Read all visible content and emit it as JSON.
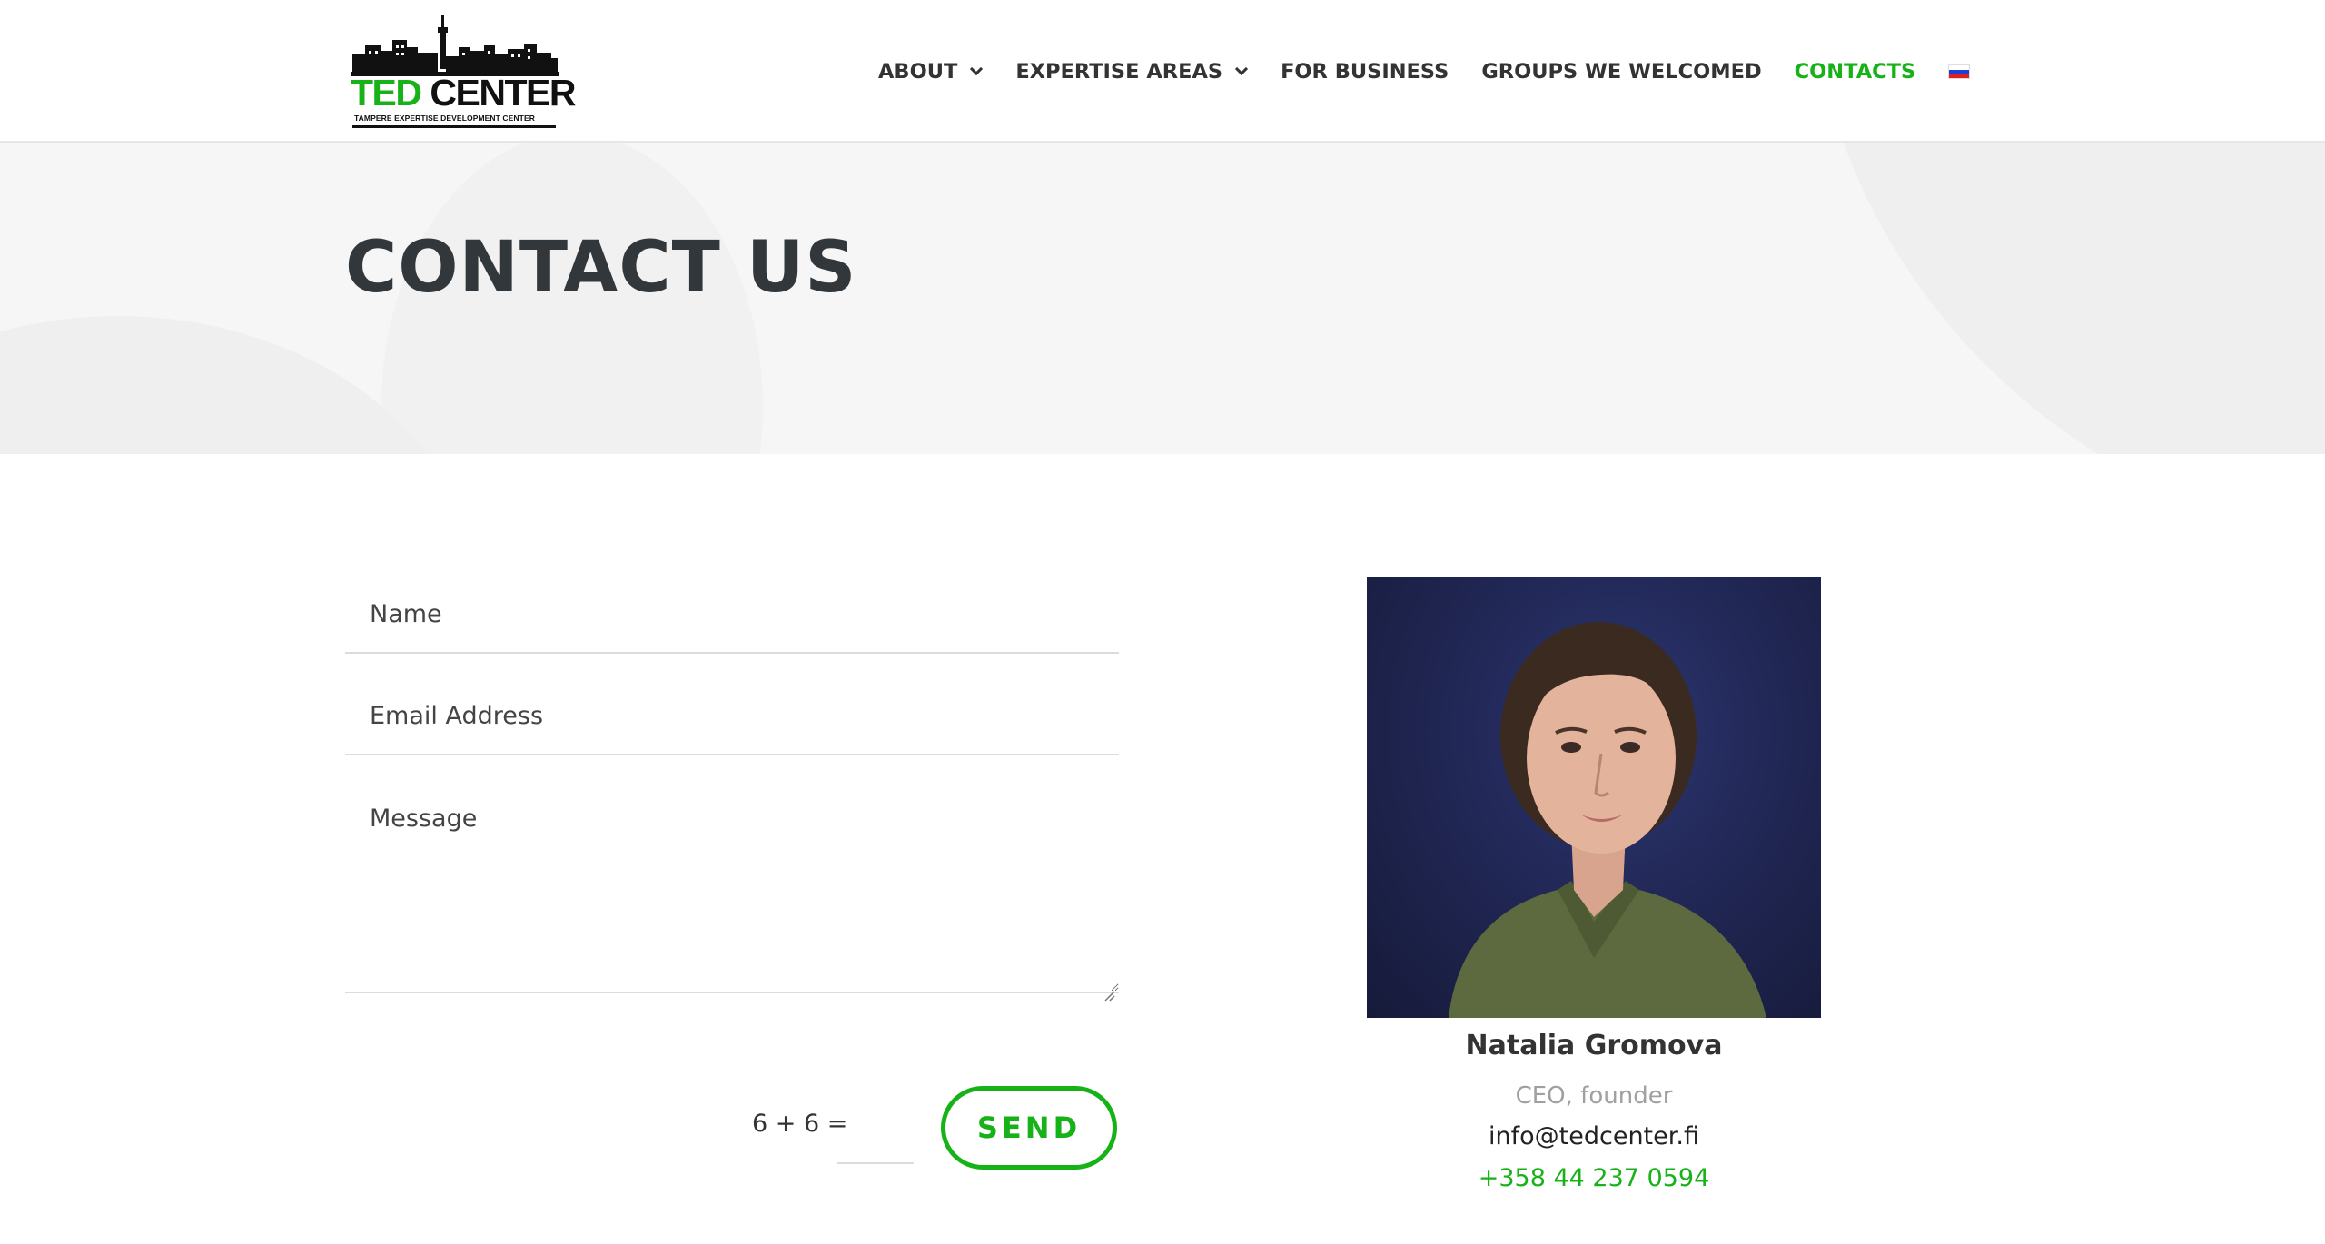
{
  "brand": {
    "logo_word_green": "TED",
    "logo_word_black": "CENTER",
    "logo_subtitle": "TAMPERE EXPERTISE DEVELOPMENT CENTER",
    "accent_color": "#17b217",
    "text_color": "#333333"
  },
  "nav": {
    "items": [
      {
        "label": "ABOUT",
        "has_dropdown": true
      },
      {
        "label": "EXPERTISE AREAS",
        "has_dropdown": true
      },
      {
        "label": "FOR BUSINESS",
        "has_dropdown": false
      },
      {
        "label": "GROUPS WE WELCOMED",
        "has_dropdown": false
      },
      {
        "label": "CONTACTS",
        "has_dropdown": false,
        "active": true
      }
    ],
    "language_flag_icon": "russian-flag-icon"
  },
  "hero": {
    "title": "CONTACT US"
  },
  "form": {
    "name_placeholder": "Name",
    "email_placeholder": "Email Address",
    "message_placeholder": "Message",
    "captcha_question": "6 + 6 =",
    "submit_label": "SEND"
  },
  "contact": {
    "name": "Natalia Gromova",
    "role": "CEO, founder",
    "email": "info@tedcenter.fi",
    "phone": "+358 44 237 0594"
  }
}
